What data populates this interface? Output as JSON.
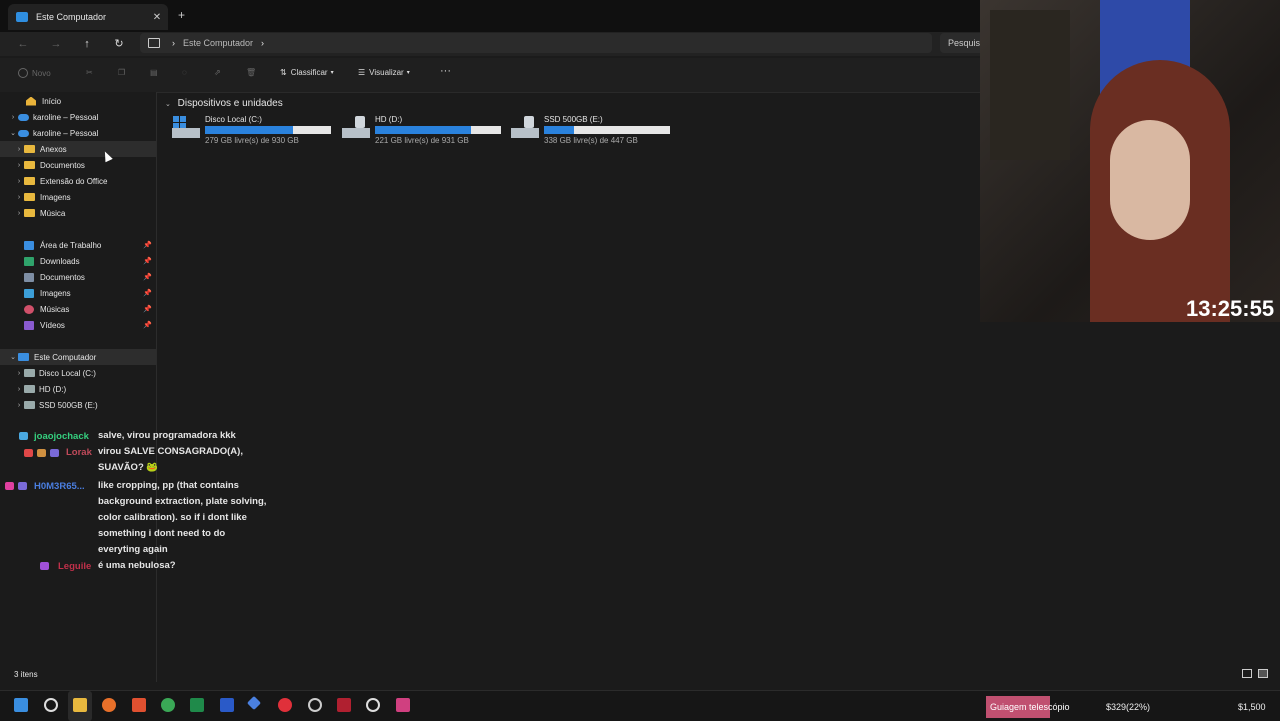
{
  "window": {
    "tab_title": "Este Computador",
    "tab_close": "✕",
    "new_tab": "+"
  },
  "nav": {
    "back": "←",
    "forward": "→",
    "up": "↑",
    "refresh": "↻",
    "breadcrumb": "Este Computador",
    "chevron": "›",
    "search_placeholder": "Pesquisar"
  },
  "toolbar": {
    "new_label": "Novo",
    "sort_label": "Classificar",
    "view_label": "Visualizar",
    "more_label": "···"
  },
  "sidebar": {
    "home": "Início",
    "onedrive_1": "karoline – Pessoal",
    "onedrive_2": "karoline – Pessoal",
    "folders": [
      "Anexos",
      "Documentos",
      "Extensão do Office",
      "Imagens",
      "Música"
    ],
    "quick": [
      "Área de Trabalho",
      "Downloads",
      "Documentos",
      "Imagens",
      "Músicas",
      "Vídeos"
    ],
    "this_pc": "Este Computador",
    "drives": [
      "Disco Local (C:)",
      "HD (D:)",
      "SSD 500GB (E:)"
    ]
  },
  "content": {
    "section_title": "Dispositivos e unidades",
    "drives": [
      {
        "name": "Disco Local (C:)",
        "free": "279 GB livre(s) de 930 GB",
        "used_fraction": 0.7
      },
      {
        "name": "HD (D:)",
        "free": "221 GB livre(s) de 931 GB",
        "used_fraction": 0.76
      },
      {
        "name": "SSD 500GB (E:)",
        "free": "338 GB livre(s) de 447 GB",
        "used_fraction": 0.24
      }
    ]
  },
  "status": {
    "count": "3 itens"
  },
  "chat": [
    {
      "user": "joaojochack",
      "user_color": "#35d07f",
      "text": "salve, virou programadora kkk"
    },
    {
      "user": "Lorak",
      "user_color": "#c04a5a",
      "text": "virou SALVE CONSAGRADO(A), SUAVÃO? 🐸"
    },
    {
      "user": "H0M3R65...",
      "user_color": "#4a7ee0",
      "text": "like cropping, pp (that contains background extraction, plate solving, color calibration). so if i dont like something i dont need to do everyting again"
    },
    {
      "user": "Leguile",
      "user_color": "#c0304a",
      "text": "é uma nebulosa?"
    }
  ],
  "overlay": {
    "clock": "13:25:55",
    "goal_label": "Guiagem telescópio",
    "goal_progress": "$329(22%)",
    "goal_target": "$1,500"
  }
}
